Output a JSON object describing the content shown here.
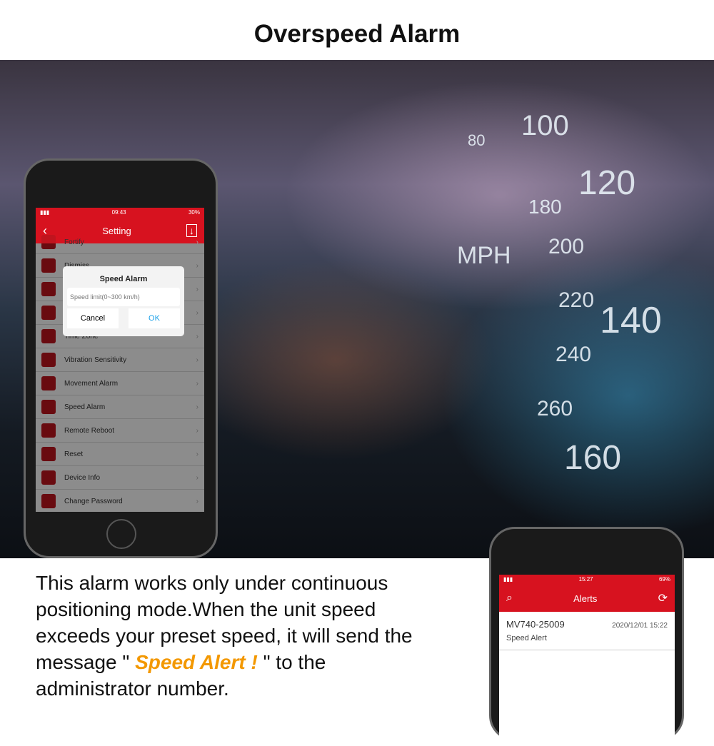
{
  "title": "Overspeed Alarm",
  "gauge": {
    "unit": "MPH",
    "marks": [
      "80",
      "100",
      "120",
      "140",
      "160",
      "180",
      "200",
      "220",
      "240",
      "260"
    ]
  },
  "description": {
    "line1": "This alarm works only under continuous",
    "line2": "positioning mode.When the unit speed",
    "line3": "exceeds your preset speed, it will send the",
    "line4_pre": "message \" ",
    "alert": "Speed Alert !",
    "line4_post": " \" to the",
    "line5": "administrator number."
  },
  "setting_phone": {
    "time": "09:43",
    "battery": "30%",
    "header": "Setting",
    "items": [
      "Fortify",
      "Dismiss",
      "",
      "",
      "Time Zone",
      "Vibration Sensitivity",
      "Movement Alarm",
      "Speed Alarm",
      "Remote Reboot",
      "Reset",
      "Device Info",
      "Change Password"
    ],
    "dialog": {
      "title": "Speed Alarm",
      "placeholder": "Speed limit(0~300 km/h)",
      "cancel": "Cancel",
      "ok": "OK"
    }
  },
  "alerts_phone": {
    "time": "15:27",
    "battery": "69%",
    "header": "Alerts",
    "device": "MV740-25009",
    "timestamp": "2020/12/01 15:22",
    "message": "Speed Alert"
  },
  "colors": {
    "brand_red": "#d7121f",
    "alert_orange": "#f39800",
    "ok_blue": "#1aa0e8"
  }
}
